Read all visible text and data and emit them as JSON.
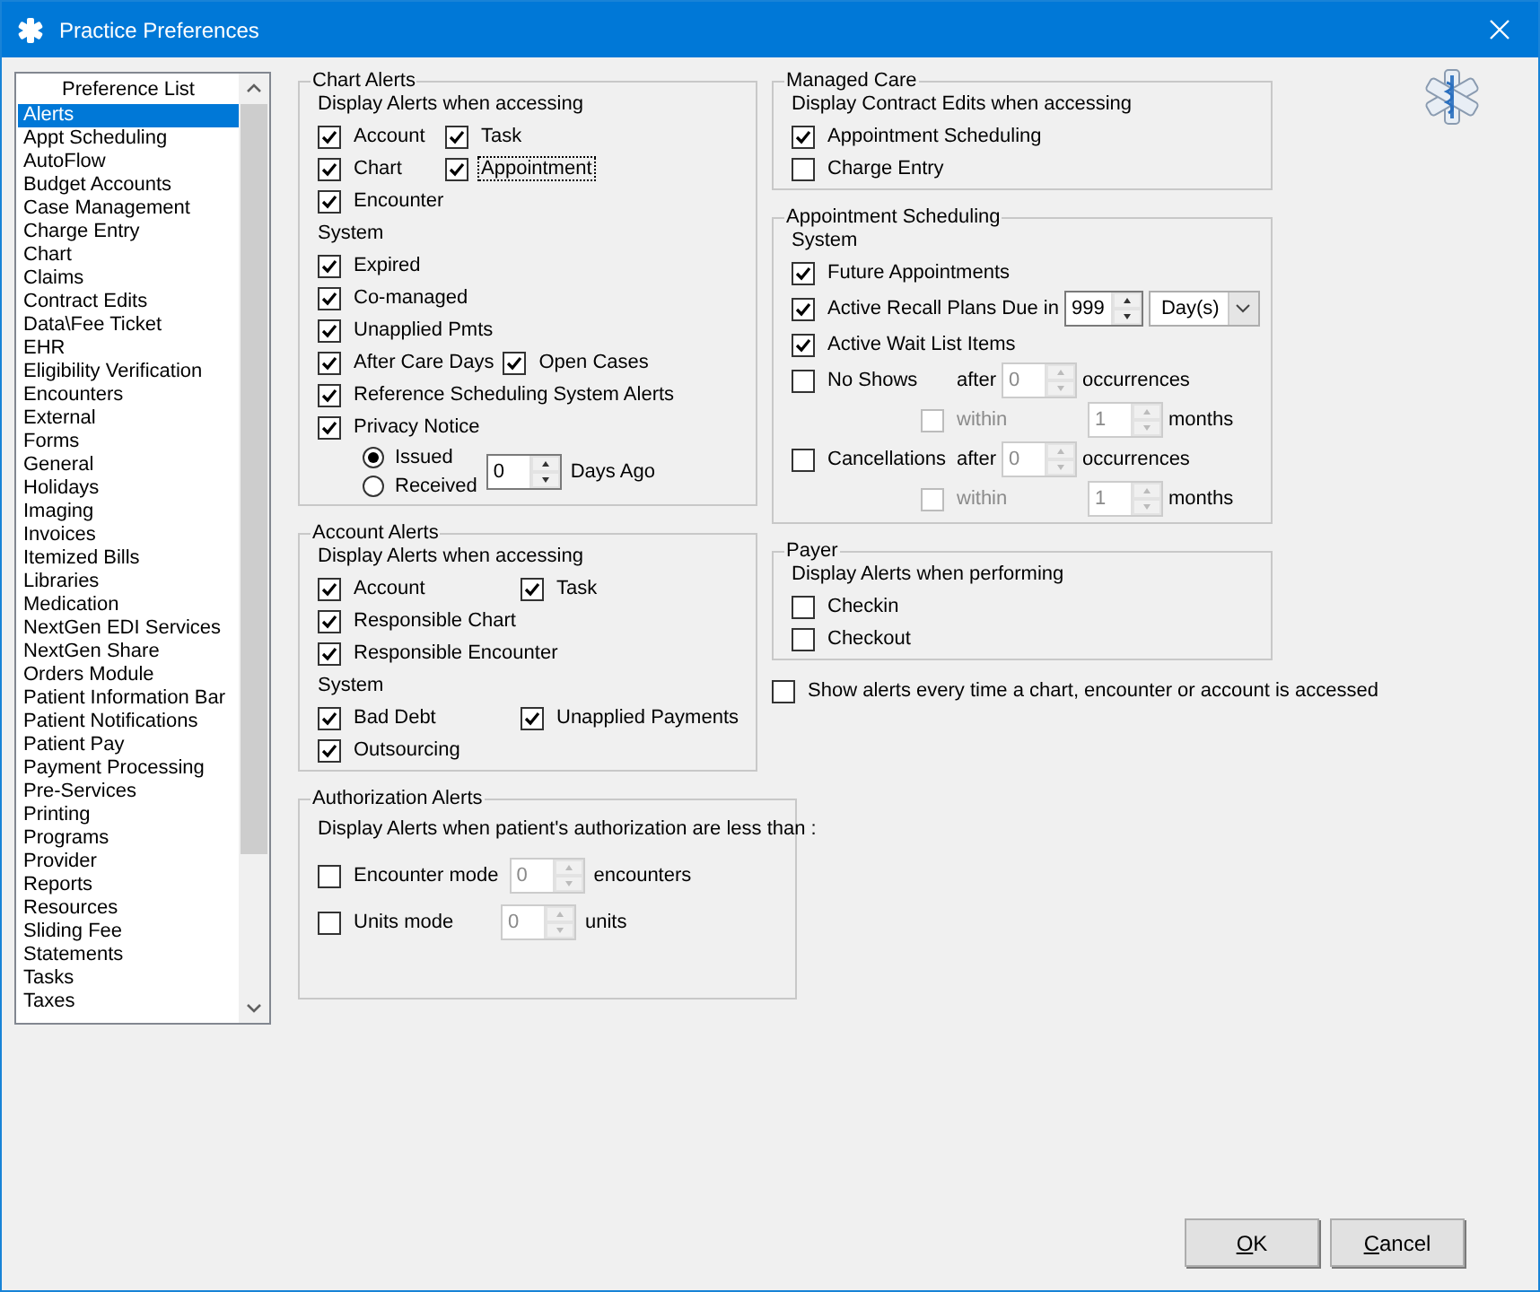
{
  "window": {
    "title": "Practice Preferences"
  },
  "preference_list": {
    "header": "Preference List",
    "items": [
      {
        "label": "Alerts",
        "selected": true
      },
      {
        "label": "Appt Scheduling",
        "selected": false
      },
      {
        "label": "AutoFlow",
        "selected": false
      },
      {
        "label": "Budget Accounts",
        "selected": false
      },
      {
        "label": "Case Management",
        "selected": false
      },
      {
        "label": "Charge Entry",
        "selected": false
      },
      {
        "label": "Chart",
        "selected": false
      },
      {
        "label": "Claims",
        "selected": false
      },
      {
        "label": "Contract Edits",
        "selected": false
      },
      {
        "label": "Data\\Fee Ticket",
        "selected": false
      },
      {
        "label": "EHR",
        "selected": false
      },
      {
        "label": "Eligibility Verification",
        "selected": false
      },
      {
        "label": "Encounters",
        "selected": false
      },
      {
        "label": "External",
        "selected": false
      },
      {
        "label": "Forms",
        "selected": false
      },
      {
        "label": "General",
        "selected": false
      },
      {
        "label": "Holidays",
        "selected": false
      },
      {
        "label": "Imaging",
        "selected": false
      },
      {
        "label": "Invoices",
        "selected": false
      },
      {
        "label": "Itemized Bills",
        "selected": false
      },
      {
        "label": "Libraries",
        "selected": false
      },
      {
        "label": "Medication",
        "selected": false
      },
      {
        "label": "NextGen EDI Services",
        "selected": false
      },
      {
        "label": "NextGen Share",
        "selected": false
      },
      {
        "label": "Orders Module",
        "selected": false
      },
      {
        "label": "Patient Information Bar",
        "selected": false
      },
      {
        "label": "Patient Notifications",
        "selected": false
      },
      {
        "label": "Patient Pay",
        "selected": false
      },
      {
        "label": "Payment Processing",
        "selected": false
      },
      {
        "label": "Pre-Services",
        "selected": false
      },
      {
        "label": "Printing",
        "selected": false
      },
      {
        "label": "Programs",
        "selected": false
      },
      {
        "label": "Provider",
        "selected": false
      },
      {
        "label": "Reports",
        "selected": false
      },
      {
        "label": "Resources",
        "selected": false
      },
      {
        "label": "Sliding Fee",
        "selected": false
      },
      {
        "label": "Statements",
        "selected": false
      },
      {
        "label": "Tasks",
        "selected": false
      },
      {
        "label": "Taxes",
        "selected": false
      }
    ]
  },
  "chart_alerts": {
    "title": "Chart Alerts",
    "rows": [
      {
        "items": [
          {
            "kind": "label",
            "text": "Display Alerts when accessing"
          }
        ]
      },
      {
        "items": [
          {
            "kind": "checkbox",
            "label": "Account",
            "checked": true
          },
          {
            "kind": "checkbox",
            "label": "Task",
            "checked": true
          }
        ]
      },
      {
        "items": [
          {
            "kind": "checkbox",
            "label": "Chart",
            "checked": true
          },
          {
            "kind": "checkbox",
            "label": "Appointment",
            "checked": true,
            "focused": true
          }
        ]
      },
      {
        "items": [
          {
            "kind": "checkbox",
            "label": "Encounter",
            "checked": true
          }
        ]
      },
      {
        "items": [
          {
            "kind": "label",
            "text": "System"
          }
        ]
      },
      {
        "items": [
          {
            "kind": "checkbox",
            "label": "Expired",
            "checked": true
          }
        ]
      },
      {
        "items": [
          {
            "kind": "checkbox",
            "label": "Co-managed",
            "checked": true
          }
        ]
      },
      {
        "items": [
          {
            "kind": "checkbox",
            "label": "Unapplied Pmts",
            "checked": true
          }
        ]
      },
      {
        "items": [
          {
            "kind": "checkbox",
            "label": "After Care Days",
            "checked": true
          },
          {
            "kind": "checkbox",
            "label": "Open Cases",
            "checked": true
          }
        ]
      },
      {
        "items": [
          {
            "kind": "checkbox",
            "label": "Reference Scheduling System Alerts",
            "checked": true
          }
        ]
      },
      {
        "items": [
          {
            "kind": "checkbox",
            "label": "Privacy Notice",
            "checked": true
          }
        ],
        "children": [
          {
            "items": [
              {
                "kind": "radio_group",
                "options": [
                  {
                    "label": "Issued",
                    "selected": true
                  },
                  {
                    "label": "Received",
                    "selected": false
                  }
                ]
              },
              {
                "kind": "spinner",
                "value": "0",
                "disabled": false
              },
              {
                "kind": "label",
                "text": "Days Ago"
              }
            ]
          }
        ]
      }
    ]
  },
  "account_alerts": {
    "title": "Account Alerts",
    "rows": [
      {
        "items": [
          {
            "kind": "label",
            "text": "Display Alerts when accessing"
          }
        ]
      },
      {
        "items": [
          {
            "kind": "checkbox",
            "label": "Account",
            "checked": true
          },
          {
            "kind": "checkbox",
            "label": "Task",
            "checked": true
          }
        ]
      },
      {
        "items": [
          {
            "kind": "checkbox",
            "label": "Responsible Chart",
            "checked": true
          }
        ]
      },
      {
        "items": [
          {
            "kind": "checkbox",
            "label": "Responsible Encounter",
            "checked": true
          }
        ]
      },
      {
        "items": [
          {
            "kind": "label",
            "text": "System"
          }
        ]
      },
      {
        "items": [
          {
            "kind": "checkbox",
            "label": "Bad Debt",
            "checked": true
          },
          {
            "kind": "checkbox",
            "label": "Unapplied Payments",
            "checked": true
          }
        ]
      },
      {
        "items": [
          {
            "kind": "checkbox",
            "label": "Outsourcing",
            "checked": true
          }
        ]
      }
    ]
  },
  "authorization_alerts": {
    "title": "Authorization Alerts",
    "rows": [
      {
        "items": [
          {
            "kind": "label",
            "text": "Display Alerts when patient's authorization are less than :"
          }
        ]
      },
      {
        "items": [
          {
            "kind": "checkbox",
            "label": "Encounter mode",
            "checked": false
          },
          {
            "kind": "spinner",
            "value": "0",
            "disabled": true
          },
          {
            "kind": "label",
            "text": "encounters"
          }
        ]
      },
      {
        "items": [
          {
            "kind": "checkbox",
            "label": "Units mode",
            "checked": false
          },
          {
            "kind": "spinner",
            "value": "0",
            "disabled": true
          },
          {
            "kind": "label",
            "text": "units"
          }
        ]
      }
    ]
  },
  "managed_care": {
    "title": "Managed Care",
    "rows": [
      {
        "items": [
          {
            "kind": "label",
            "text": "Display Contract Edits when accessing"
          }
        ]
      },
      {
        "items": [
          {
            "kind": "checkbox",
            "label": "Appointment Scheduling",
            "checked": true
          }
        ]
      },
      {
        "items": [
          {
            "kind": "checkbox",
            "label": "Charge Entry",
            "checked": false
          }
        ]
      }
    ]
  },
  "appointment_scheduling": {
    "title": "Appointment Scheduling",
    "rows": [
      {
        "items": [
          {
            "kind": "label",
            "text": "System"
          }
        ]
      },
      {
        "items": [
          {
            "kind": "checkbox",
            "label": "Future Appointments",
            "checked": true
          }
        ]
      },
      {
        "items": [
          {
            "kind": "checkbox",
            "label": "Active Recall Plans",
            "checked": true
          },
          {
            "kind": "label",
            "text": "Due in"
          },
          {
            "kind": "spinner",
            "value": "999",
            "disabled": false
          },
          {
            "kind": "dropdown",
            "value": "Day(s)"
          }
        ]
      },
      {
        "items": [
          {
            "kind": "checkbox",
            "label": "Active Wait List Items",
            "checked": true
          }
        ]
      },
      {
        "items": [
          {
            "kind": "checkbox",
            "label": "No Shows",
            "checked": false
          },
          {
            "kind": "label",
            "text": "after"
          },
          {
            "kind": "spinner",
            "value": "0",
            "disabled": true
          },
          {
            "kind": "label",
            "text": "occurrences"
          }
        ],
        "children": [
          {
            "items": [
              {
                "kind": "checkbox",
                "label": "within",
                "checked": false,
                "disabled": true
              },
              {
                "kind": "spinner",
                "value": "1",
                "disabled": true
              },
              {
                "kind": "label",
                "text": "months"
              }
            ]
          }
        ]
      },
      {
        "items": [
          {
            "kind": "checkbox",
            "label": "Cancellations",
            "checked": false
          },
          {
            "kind": "label",
            "text": "after"
          },
          {
            "kind": "spinner",
            "value": "0",
            "disabled": true
          },
          {
            "kind": "label",
            "text": "occurrences"
          }
        ],
        "children": [
          {
            "items": [
              {
                "kind": "checkbox",
                "label": "within",
                "checked": false,
                "disabled": true
              },
              {
                "kind": "spinner",
                "value": "1",
                "disabled": true
              },
              {
                "kind": "label",
                "text": "months"
              }
            ]
          }
        ]
      }
    ]
  },
  "payer": {
    "title": "Payer",
    "rows": [
      {
        "items": [
          {
            "kind": "label",
            "text": "Display Alerts when performing"
          }
        ]
      },
      {
        "items": [
          {
            "kind": "checkbox",
            "label": "Checkin",
            "checked": false
          }
        ]
      },
      {
        "items": [
          {
            "kind": "checkbox",
            "label": "Checkout",
            "checked": false
          }
        ]
      }
    ]
  },
  "show_alerts": {
    "label": "Show alerts every time a chart, encounter or account is accessed",
    "checked": false
  },
  "buttons": [
    {
      "label": "OK"
    },
    {
      "label": "Cancel"
    }
  ]
}
